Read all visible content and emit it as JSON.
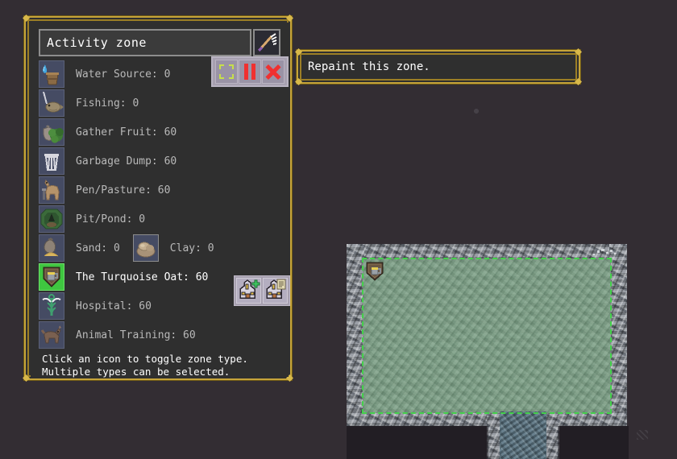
{
  "window": {
    "title": "Activity zone",
    "rename_icon": "quill-icon"
  },
  "controls": [
    {
      "name": "repaint-zone-button",
      "icon": "dashed-square-icon",
      "label": "Repaint"
    },
    {
      "name": "pause-zone-button",
      "icon": "pause-icon",
      "label": "Pause"
    },
    {
      "name": "close-window-button",
      "icon": "close-x-icon",
      "label": "Close"
    }
  ],
  "zone_types": [
    {
      "icon": "water-source-icon",
      "label": "Water Source: 0",
      "value": 0,
      "selected": false
    },
    {
      "icon": "fishing-icon",
      "label": "Fishing: 0",
      "value": 0,
      "selected": false
    },
    {
      "icon": "gather-fruit-icon",
      "label": "Gather Fruit: 60",
      "value": 60,
      "selected": false
    },
    {
      "icon": "garbage-dump-icon",
      "label": "Garbage Dump: 60",
      "value": 60,
      "selected": false
    },
    {
      "icon": "pen-pasture-icon",
      "label": "Pen/Pasture: 60",
      "value": 60,
      "selected": false
    },
    {
      "icon": "pit-pond-icon",
      "label": "Pit/Pond: 0",
      "value": 0,
      "selected": false
    },
    {
      "icon": "sand-icon",
      "label": "Sand: 0",
      "value": 0,
      "selected": false,
      "second_icon": "clay-icon",
      "second_label": "Clay: 0",
      "second_value": 0
    },
    {
      "icon": "tavern-icon",
      "label": "The Turquoise Oat: 60",
      "value": 60,
      "selected": true
    },
    {
      "icon": "hospital-icon",
      "label": "Hospital: 60",
      "value": 60,
      "selected": false
    },
    {
      "icon": "animal-training-icon",
      "label": "Animal Training: 60",
      "value": 60,
      "selected": false
    }
  ],
  "room_buttons": [
    {
      "name": "add-room-button",
      "icon": "house-plus-icon"
    },
    {
      "name": "room-details-button",
      "icon": "house-list-icon"
    }
  ],
  "hint": "Click an icon to toggle zone type.\nMultiple types can be selected.",
  "tooltip": {
    "text": "Repaint this zone."
  },
  "map": {
    "zone_sign_icon": "tavern-sign-icon",
    "selection_color": "#43d14a",
    "floor_color": "#7fa188",
    "wall_color": "#8e939b",
    "corridor_color": "#5e7785"
  },
  "colors": {
    "background": "#332d33",
    "frame_gold": "#c6a43a",
    "panel_bg": "#2f2f2f",
    "text_dim": "#b9b9b9",
    "text_bright": "#ffffff",
    "accent_red": "#f03030",
    "accent_green": "#3fc640",
    "icon_slot_bg": "#454b63"
  }
}
